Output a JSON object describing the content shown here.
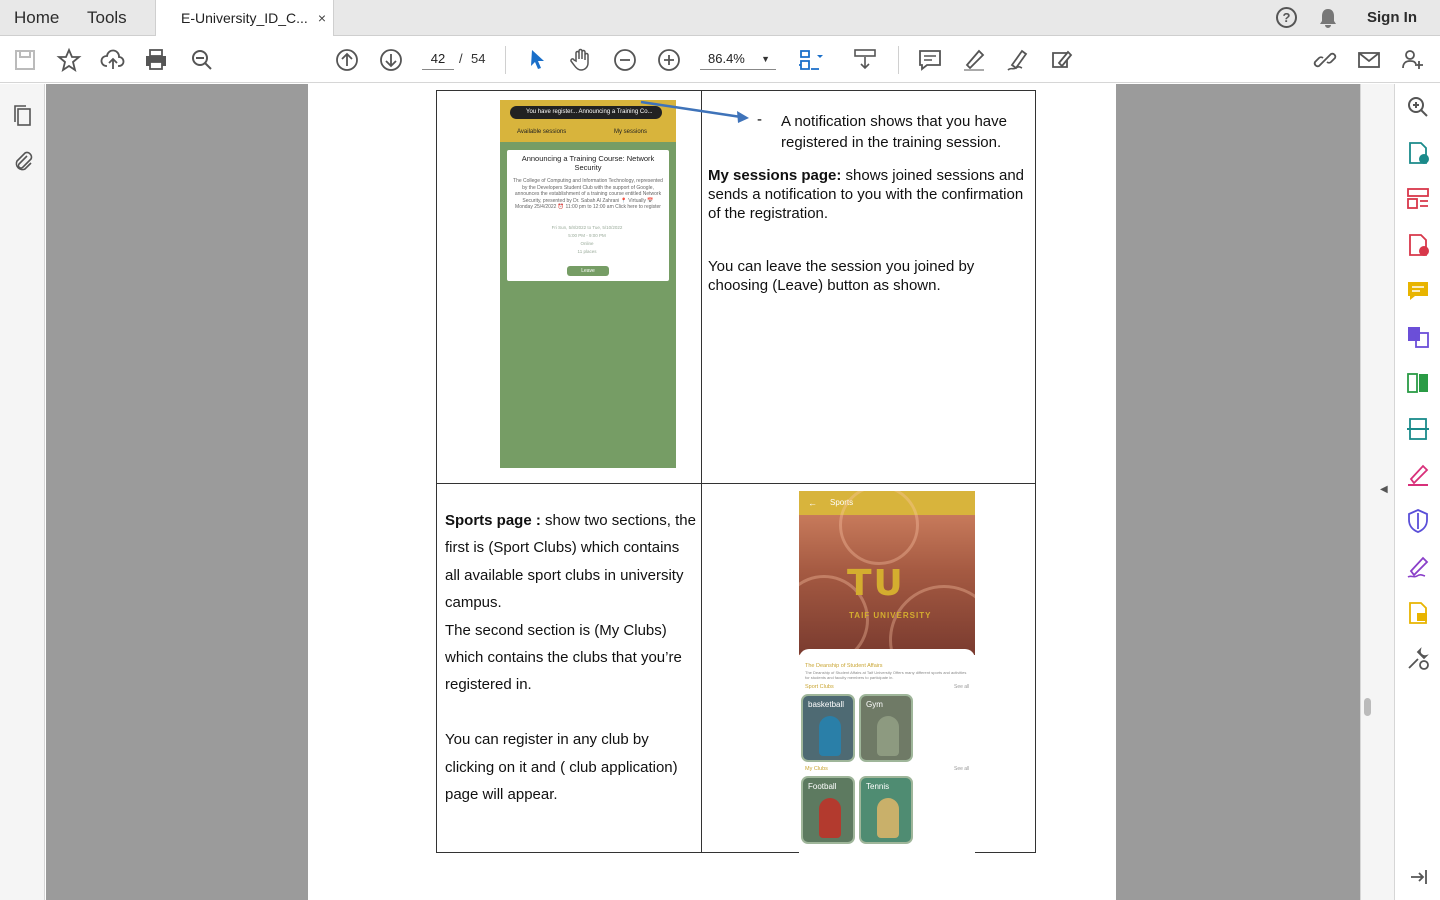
{
  "tabbar": {
    "home_label": "Home",
    "tools_label": "Tools",
    "file_tab_title": "E-University_ID_C...",
    "close_glyph": "×",
    "signin_label": "Sign In"
  },
  "toolbar": {
    "current_page": "42",
    "page_separator": "/",
    "total_pages": "54",
    "zoom": "86.4%"
  },
  "document": {
    "notification_dash": "-",
    "notification_text": "A notification shows that you have registered in the training session.",
    "sessions_bold": "My sessions page:",
    "sessions_text": " shows joined sessions and sends a notification to you with the confirmation of the registration.",
    "leave_text": "You can leave the session you joined by choosing (Leave)  button as shown.",
    "sports_bold": "Sports page :",
    "sports_text_1": " show two sections, the first is (Sport Clubs) which contains all available sport clubs in university campus.",
    "sports_text_2": "The second section is (My Clubs) which contains the clubs that you’re registered in.",
    "sports_text_3": "You can register in any club by clicking on it and ( club application) page will appear."
  },
  "phone_sessions": {
    "toast": "You have register...   Announcing a Training Co...",
    "tab_available": "Available sessions",
    "tab_my": "My sessions",
    "card_title": "Announcing a Training Course: Network Security",
    "card_body": "The College of Computing and Information Technology, represented by the Developers Student Club with the support of Google, announces the establishment of a training course entitled Network Security, presented by Dr. Sabah Al Zahrani 📍 Virtually 📅 Monday 25/4/2022 ⏰ 11:00 pm to 12:00 am Click here to register",
    "meta_date": "Fri Sun, 5/8/2022 to Tue, 5/10/2022",
    "meta_time": "5:00 PM - 9:00 PM",
    "meta_place": "Online",
    "meta_seats": "11 places",
    "leave_button": "Leave"
  },
  "phone_sports": {
    "title": "Sports",
    "logo": "TU",
    "logo_sub": "TAIF UNIVERSITY",
    "deanship_title": "The Deanship of Student Affairs",
    "deanship_body": "The Deanship of Student Affairs at Taif University Offers many different sports and activities for students and faculty members to participate in.",
    "sport_clubs": "Sport Clubs",
    "my_clubs": "My Clubs",
    "see_all": "See all",
    "clubs": [
      "basketball",
      "Gym"
    ],
    "my_club_list": [
      "Football",
      "Tennis"
    ]
  },
  "colors": {
    "accent_gold": "#d8b43c",
    "phone_green": "#769d65",
    "viewer_gray": "#9b9b9b"
  }
}
